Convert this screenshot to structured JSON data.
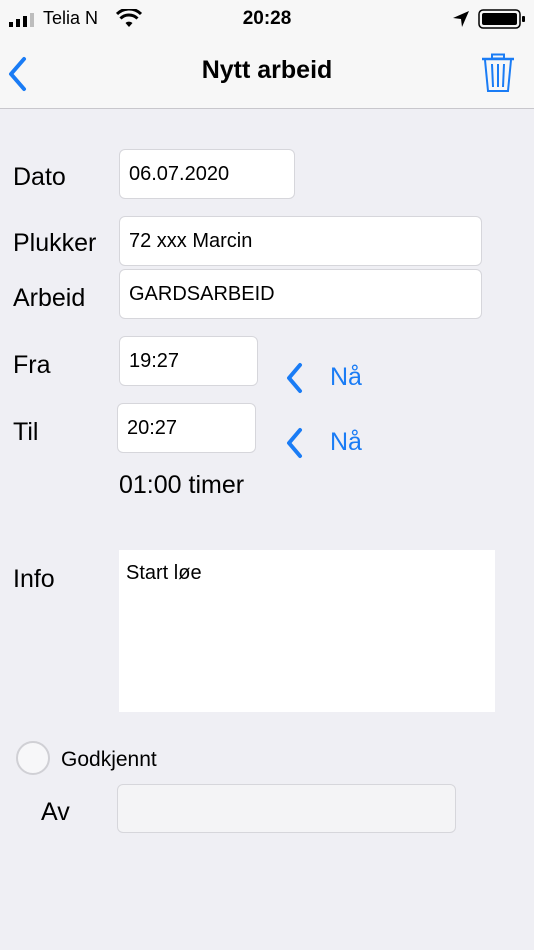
{
  "status_bar": {
    "carrier": "Telia N",
    "time": "20:28"
  },
  "nav": {
    "title": "Nytt arbeid",
    "back_icon": "chevron-left-icon",
    "delete_icon": "trash-icon"
  },
  "form": {
    "dato": {
      "label": "Dato",
      "value": "06.07.2020"
    },
    "plukker": {
      "label": "Plukker",
      "value": "72 xxx Marcin"
    },
    "arbeid": {
      "label": "Arbeid",
      "value": "GARDSARBEID"
    },
    "fra": {
      "label": "Fra",
      "value": "19:27",
      "now_label": "Nå"
    },
    "til": {
      "label": "Til",
      "value": "20:27",
      "now_label": "Nå"
    },
    "duration": "01:00 timer",
    "info": {
      "label": "Info",
      "value": "Start løe"
    },
    "godkjent": {
      "label": "Godkjennt",
      "checked": false
    },
    "av": {
      "label": "Av",
      "value": ""
    }
  },
  "colors": {
    "accent": "#1a7cf5",
    "background": "#efeff4"
  }
}
